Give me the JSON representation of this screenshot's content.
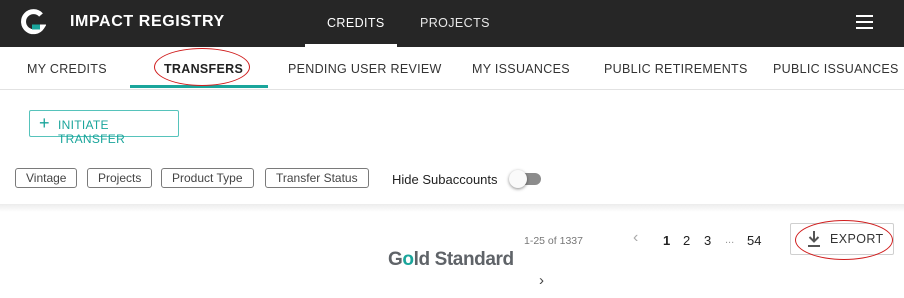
{
  "app": {
    "title": "IMPACT REGISTRY",
    "logo_letter": "G"
  },
  "top_nav": [
    {
      "label": "CREDITS",
      "active": true
    },
    {
      "label": "PROJECTS",
      "active": false
    }
  ],
  "sub_tabs": [
    {
      "label": "MY CREDITS",
      "active": false
    },
    {
      "label": "TRANSFERS",
      "active": true
    },
    {
      "label": "PENDING USER REVIEW",
      "active": false
    },
    {
      "label": "MY ISSUANCES",
      "active": false
    },
    {
      "label": "PUBLIC RETIREMENTS",
      "active": false
    },
    {
      "label": "PUBLIC ISSUANCES",
      "active": false
    }
  ],
  "actions": {
    "initiate_label": "INITIATE TRANSFER",
    "export_label": "EXPORT"
  },
  "filters": [
    "Vintage",
    "Projects",
    "Product Type",
    "Transfer Status"
  ],
  "hide_subaccounts": {
    "label": "Hide Subaccounts",
    "on": false
  },
  "footer": {
    "brand": {
      "prefix": "G",
      "o": "o",
      "rest": "ld Standard"
    },
    "results_count": "1-25 of 1337",
    "pages": [
      "1",
      "2",
      "3",
      "54"
    ],
    "ellipsis": "...",
    "current_page": "1"
  },
  "colors": {
    "topbar": "#262626",
    "accent": "#1aa59b",
    "annotation": "#d01d1d"
  },
  "icons": {
    "menu": "hamburger-icon",
    "prev": "chevron-left-icon",
    "next": "chevron-right-icon",
    "export": "download-icon",
    "add": "plus-icon"
  }
}
